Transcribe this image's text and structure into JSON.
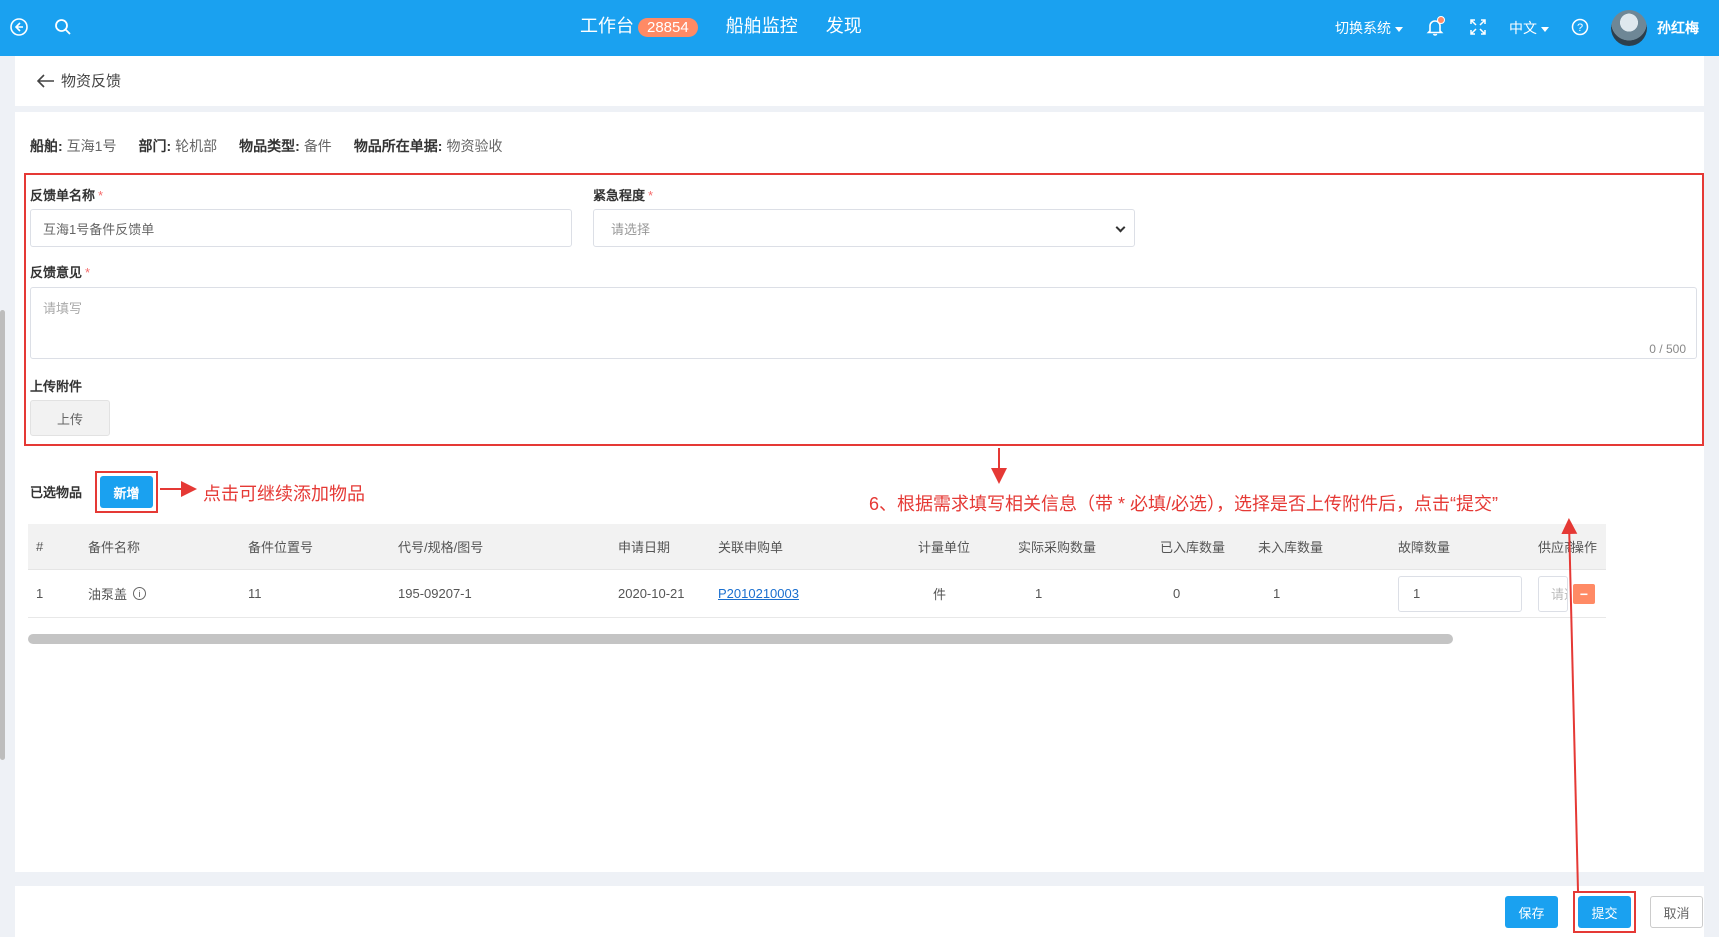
{
  "topbar": {
    "nav": [
      {
        "label": "工作台",
        "badge": "28854"
      },
      {
        "label": "船舶监控"
      },
      {
        "label": "发现"
      }
    ],
    "switch_system": "切换系统",
    "language": "中文",
    "username": "孙红梅"
  },
  "page": {
    "title": "物资反馈"
  },
  "info": [
    {
      "label": "船舶:",
      "value": "互海1号"
    },
    {
      "label": "部门:",
      "value": "轮机部"
    },
    {
      "label": "物品类型:",
      "value": "备件"
    },
    {
      "label": "物品所在单据:",
      "value": "物资验收"
    }
  ],
  "form": {
    "name_label": "反馈单名称",
    "name_value": "互海1号备件反馈单",
    "urgency_label": "紧急程度",
    "urgency_placeholder": "请选择",
    "opinion_label": "反馈意见",
    "opinion_placeholder": "请填写",
    "opinion_counter": "0 / 500",
    "attach_label": "上传附件",
    "upload_button": "上传",
    "required_mark": "*"
  },
  "items": {
    "label": "已选物品",
    "add_button": "新增"
  },
  "annotations": {
    "add_hint": "点击可继续添加物品",
    "step6": "6、根据需求填写相关信息（带 * 必填/必选），选择是否上传附件后，点击“提交”"
  },
  "table": {
    "headers": [
      "#",
      "备件名称",
      "备件位置号",
      "代号/规格/图号",
      "申请日期",
      "关联申购单",
      "计量单位",
      "实际采购数量",
      "已入库数量",
      "未入库数量",
      "故障数量",
      "供应商",
      "操作"
    ],
    "rows": [
      {
        "index": "1",
        "name": "油泵盖",
        "position": "11",
        "code": "195-09207-1",
        "date": "2020-10-21",
        "order": "P2010210003",
        "unit": "件",
        "actual_qty": "1",
        "in_qty": "0",
        "not_in_qty": "1",
        "fault_qty": "1",
        "supplier_placeholder": "请选择",
        "action": "−"
      }
    ]
  },
  "footer": {
    "save": "保存",
    "submit": "提交",
    "cancel": "取消"
  },
  "colors": {
    "primary": "#1aa1f0",
    "annotation_red": "#e53935",
    "badge": "#ff8a65"
  }
}
